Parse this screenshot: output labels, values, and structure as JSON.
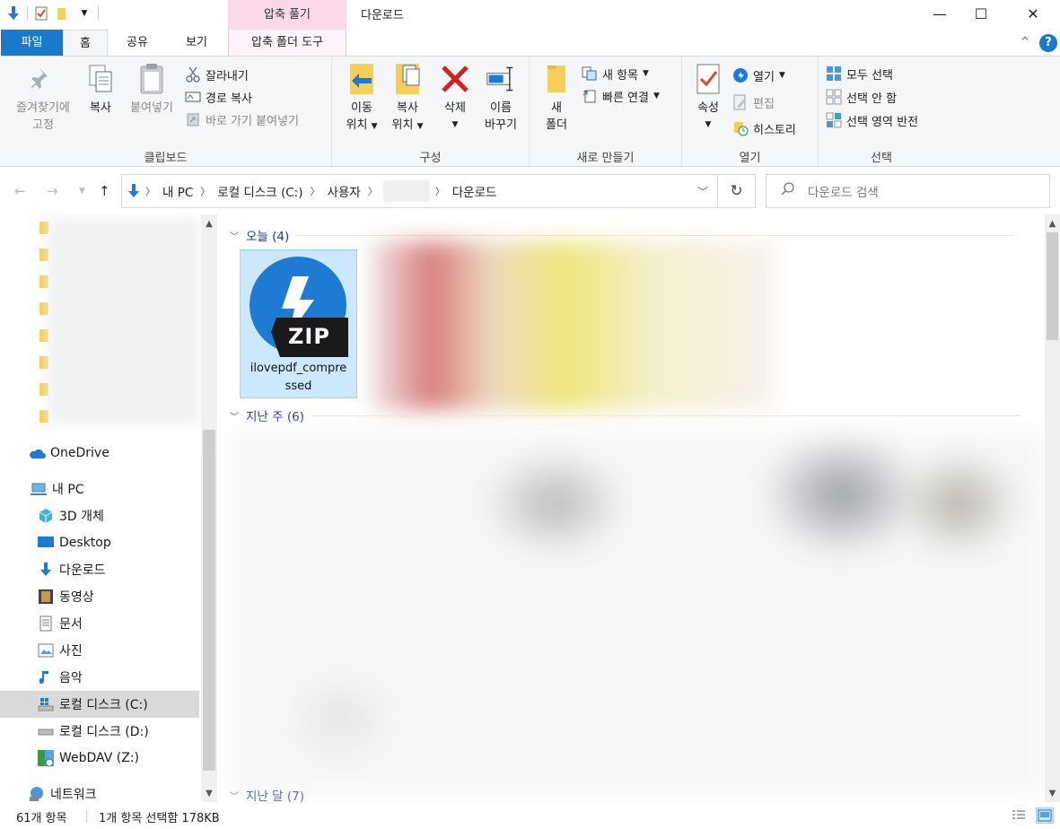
{
  "window": {
    "title": "다운로드",
    "context_tab_top": "압축 풀기",
    "controls": {
      "minimize": "—",
      "maximize": "☐",
      "close": "✕"
    }
  },
  "ribbon_tabs": {
    "file": "파일",
    "home": "홈",
    "share": "공유",
    "view": "보기",
    "tools": "압축 폴더 도구",
    "collapse": "^",
    "help": "?"
  },
  "ribbon": {
    "clipboard": {
      "label": "클립보드",
      "pin_line1": "즐겨찾기에",
      "pin_line2": "고정",
      "copy": "복사",
      "paste": "붙여넣기",
      "cut": "잘라내기",
      "copy_path": "경로 복사",
      "paste_shortcut": "바로 가기 붙여넣기"
    },
    "organize": {
      "label": "구성",
      "move_line1": "이동",
      "move_line2": "위치",
      "copyto_line1": "복사",
      "copyto_line2": "위치",
      "delete": "삭제",
      "rename_line1": "이름",
      "rename_line2": "바꾸기"
    },
    "new": {
      "label": "새로 만들기",
      "folder_line1": "새",
      "folder_line2": "폴더",
      "new_item": "새 항목",
      "easy_access": "빠른 연결"
    },
    "open": {
      "label": "열기",
      "properties": "속성",
      "open": "열기",
      "edit": "편집",
      "history": "히스토리"
    },
    "select": {
      "label": "선택",
      "select_all": "모두 선택",
      "select_none": "선택 안 함",
      "invert": "선택 영역 반전"
    }
  },
  "address": {
    "crumbs": [
      "내 PC",
      "로컬 디스크 (C:)",
      "사용자",
      "다운로드"
    ],
    "search_placeholder": "다운로드 검색"
  },
  "nav": {
    "items": [
      {
        "label": "OneDrive",
        "icon": "cloud-icon"
      },
      {
        "label": "내 PC",
        "icon": "computer-icon"
      },
      {
        "label": "3D 개체",
        "icon": "cube-icon"
      },
      {
        "label": "Desktop",
        "icon": "desktop-icon"
      },
      {
        "label": "다운로드",
        "icon": "download-arrow-icon"
      },
      {
        "label": "동영상",
        "icon": "film-icon"
      },
      {
        "label": "문서",
        "icon": "document-icon"
      },
      {
        "label": "사진",
        "icon": "picture-icon"
      },
      {
        "label": "음악",
        "icon": "music-note-icon"
      },
      {
        "label": "로컬 디스크 (C:)",
        "icon": "windows-drive-icon"
      },
      {
        "label": "로컬 디스크 (D:)",
        "icon": "drive-icon"
      },
      {
        "label": "WebDAV (Z:)",
        "icon": "network-drive-icon"
      },
      {
        "label": "네트워크",
        "icon": "network-icon"
      }
    ]
  },
  "content": {
    "groups": [
      {
        "title": "오늘 (4)"
      },
      {
        "title": "지난 주 (6)"
      },
      {
        "title": "지난 달 (7)"
      }
    ],
    "selected_file": {
      "name_line1": "ilovepdf_compre",
      "name_line2": "ssed",
      "badge": "ZIP"
    }
  },
  "status": {
    "count": "61개 항목",
    "selection": "1개 항목 선택함 178KB"
  },
  "colors": {
    "accent": "#1979ca",
    "context_tab": "#f9d9ea",
    "selection": "#cce8ff"
  }
}
